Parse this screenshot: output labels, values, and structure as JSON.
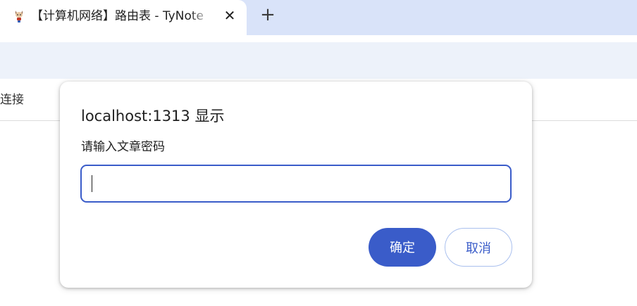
{
  "browser": {
    "tab": {
      "title": "【计算机网络】路由表 - TyNote",
      "favicon": "cat-mascot-icon",
      "close_glyph": "✕"
    },
    "new_tab_glyph": "+"
  },
  "page": {
    "partial_link_text": "连接"
  },
  "dialog": {
    "title": "localhost:1313 显示",
    "message": "请输入文章密码",
    "input_value": "",
    "ok_label": "确定",
    "cancel_label": "取消"
  },
  "colors": {
    "accent": "#3a5cc9",
    "tabstrip": "#d9e3f9",
    "toolbar": "#edf2fa"
  }
}
